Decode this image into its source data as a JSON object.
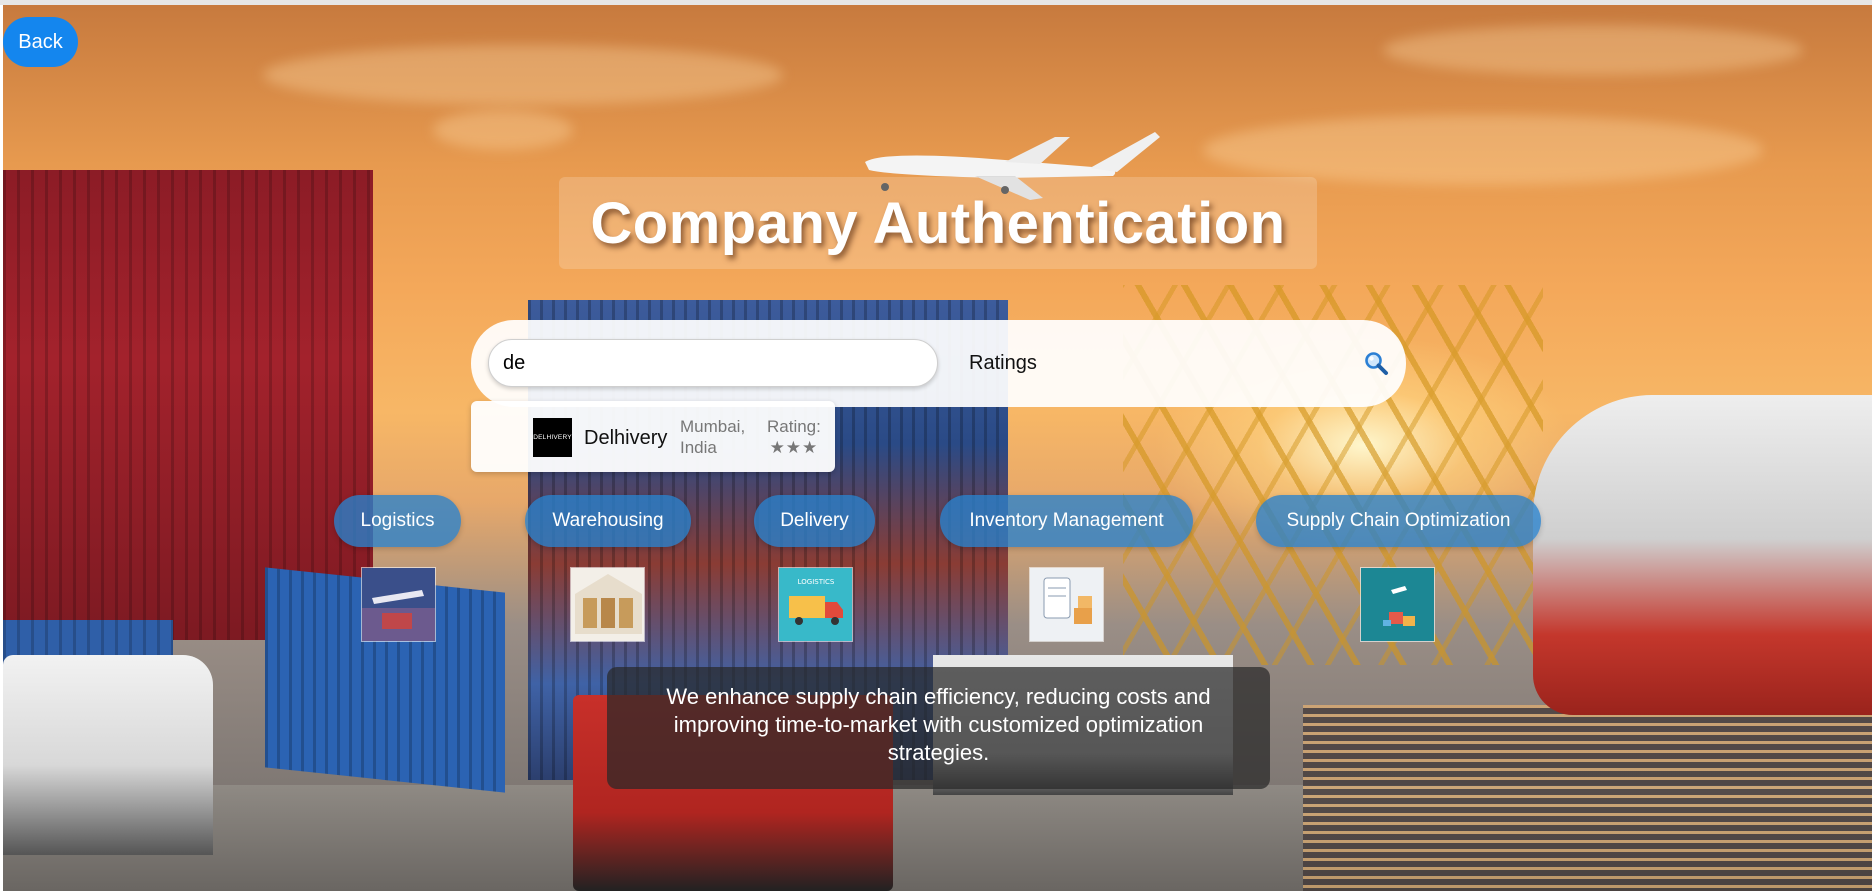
{
  "back_button": {
    "label": "Back"
  },
  "title": "Company Authentication",
  "search": {
    "query": "de",
    "ratings_label": "Ratings",
    "search_icon": "magnifier-icon"
  },
  "suggestions": [
    {
      "logo_text": "DELHIVERY",
      "name": "Delhivery",
      "location": "Mumbai, India",
      "rating_label": "Rating:",
      "stars": "★★★"
    }
  ],
  "categories": [
    {
      "label": "Logistics",
      "image_icon": "logistics-image"
    },
    {
      "label": "Warehousing",
      "image_icon": "warehouse-image"
    },
    {
      "label": "Delivery",
      "image_icon": "delivery-truck-image",
      "image_caption": "LOGISTICS"
    },
    {
      "label": "Inventory Management",
      "image_icon": "inventory-image"
    },
    {
      "label": "Supply Chain Optimization",
      "image_icon": "supply-chain-image"
    }
  ],
  "description": "We enhance supply chain efficiency, reducing costs and improving time-to-market with customized optimization strategies.",
  "colors": {
    "accent": "#1486ee",
    "category_button": "#2882cd",
    "overlay": "#282828"
  }
}
